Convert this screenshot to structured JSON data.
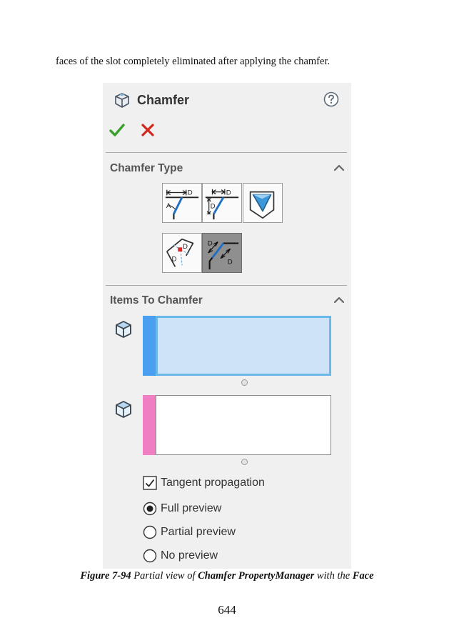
{
  "page": {
    "body_text": "faces of the slot completely eliminated after applying the chamfer.",
    "caption": {
      "figure_number": "Figure 7-94",
      "text_1": " Partial view of ",
      "bold_1": "Chamfer PropertyManager",
      "text_2": " with the ",
      "bold_2": "Face"
    },
    "page_number": "644"
  },
  "property_manager": {
    "title": "Chamfer",
    "icons": {
      "title": "chamfer-feature-icon",
      "help": "help-icon",
      "ok": "check-icon",
      "cancel": "close-icon"
    },
    "colors": {
      "ok": "#3aa02c",
      "cancel": "#d0281c",
      "active_selection_fill": "#cfe3f8",
      "active_selection_border": "#69b8ea",
      "edge_strip": "#4a9ff0",
      "face_strip": "#f07ec2"
    },
    "chamfer_type": {
      "title": "Chamfer Type",
      "buttons": [
        {
          "name": "angle-distance",
          "icon": "angle-distance-icon",
          "tag_a": "A",
          "tag_d": "D",
          "selected": false
        },
        {
          "name": "distance-distance",
          "icon": "distance-distance-icon",
          "tag_d": "D",
          "selected": false
        },
        {
          "name": "vertex",
          "icon": "vertex-chamfer-icon",
          "selected": false
        },
        {
          "name": "offset-face",
          "icon": "offset-face-icon",
          "tag_d": "D",
          "selected": false
        },
        {
          "name": "face-face",
          "icon": "face-face-icon",
          "tag_d": "D",
          "selected": true
        }
      ]
    },
    "items_to_chamfer": {
      "title": "Items To Chamfer",
      "selection_boxes": [
        {
          "name": "edges-faces-selection",
          "icon": "cube-icon",
          "active": true
        },
        {
          "name": "face-selection",
          "icon": "cube-icon",
          "active": false
        }
      ],
      "tangent_propagation": {
        "label": "Tangent propagation",
        "checked": true
      },
      "preview_options": [
        {
          "label": "Full preview",
          "selected": true
        },
        {
          "label": "Partial preview",
          "selected": false
        },
        {
          "label": "No preview",
          "selected": false
        }
      ]
    }
  }
}
